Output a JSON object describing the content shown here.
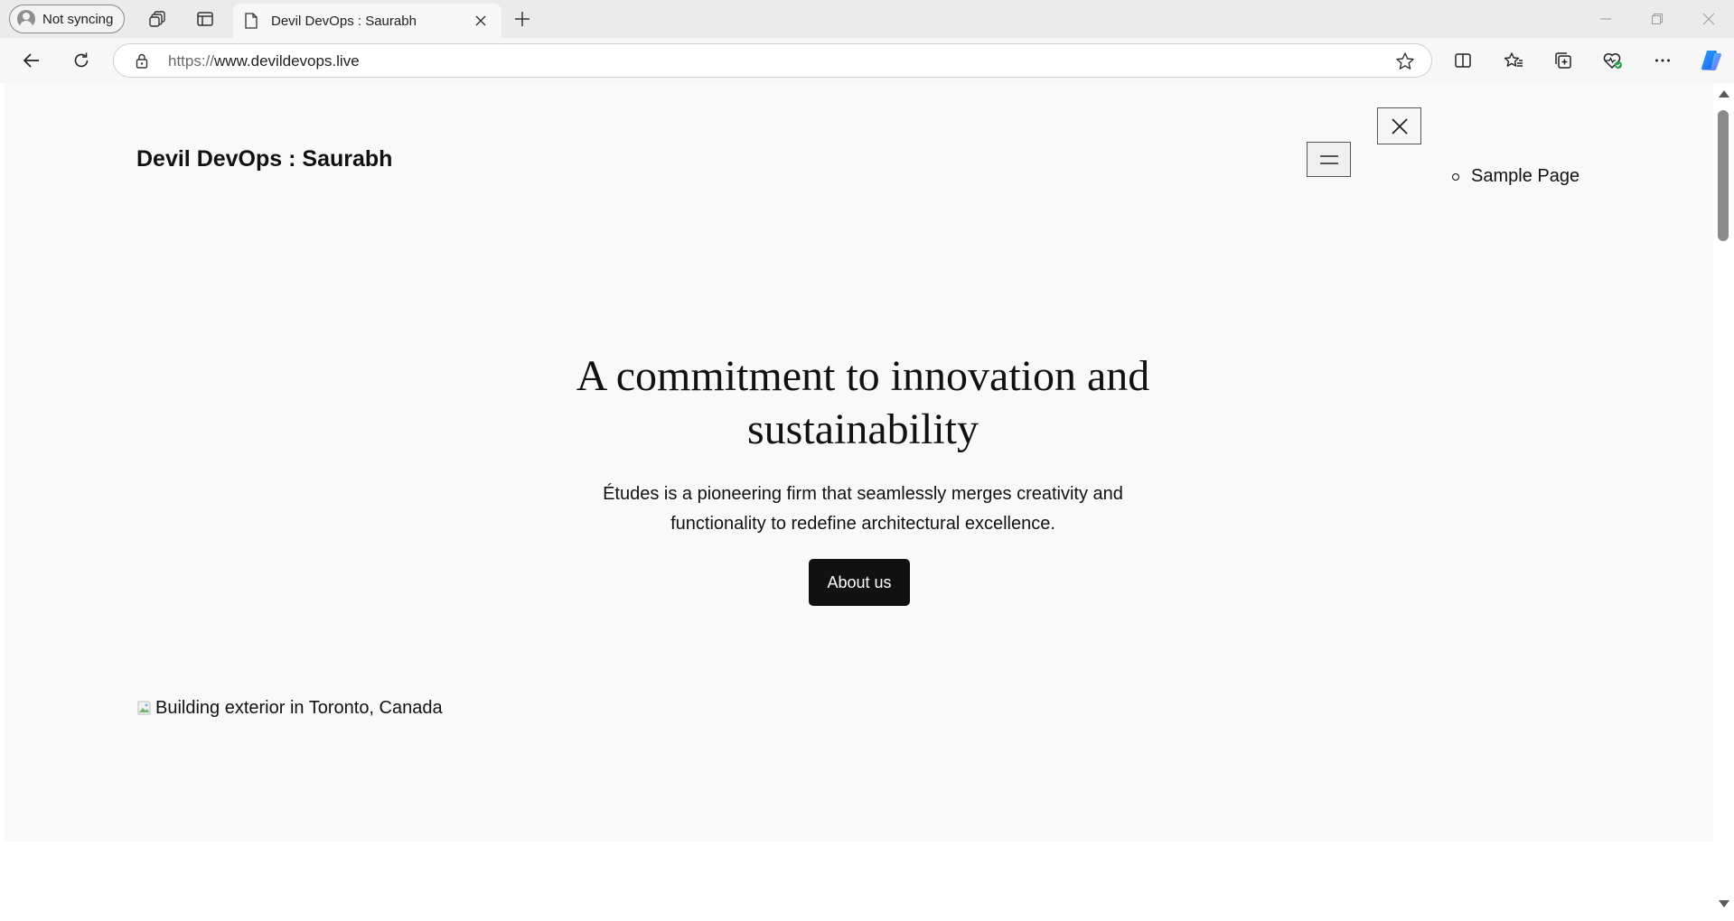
{
  "browser": {
    "profile_label": "Not syncing",
    "tab_title": "Devil DevOps : Saurabh",
    "url_protocol": "https://",
    "url_host": "www.devildevops.live"
  },
  "site": {
    "title": "Devil DevOps : Saurabh",
    "nav_items": [
      {
        "label": "Sample Page"
      }
    ],
    "hero": {
      "heading_line1": "A commitment to innovation and",
      "heading_line2": "sustainability",
      "text_line1": "Études is a pioneering firm that seamlessly merges creativity and",
      "text_line2": "functionality to redefine architectural excellence.",
      "button_label": "About us"
    },
    "image_alt": "Building exterior in Toronto, Canada"
  },
  "colors": {
    "page_bg": "#f9f9f9",
    "button_bg": "#111111",
    "copilot_accent": "#1a73e8"
  }
}
